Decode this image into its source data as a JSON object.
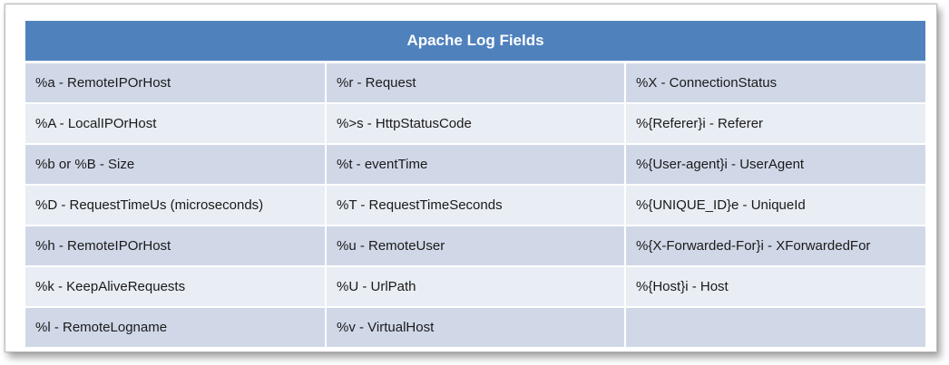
{
  "table": {
    "title": "Apache Log Fields",
    "rows": [
      [
        "%a - RemoteIPOrHost",
        "%r - Request",
        "%X - ConnectionStatus"
      ],
      [
        "%A - LocalIPOrHost",
        "%>s - HttpStatusCode",
        "%{Referer}i - Referer"
      ],
      [
        "%b or %B - Size",
        "%t - eventTime",
        "%{User-agent}i - UserAgent"
      ],
      [
        "%D - RequestTimeUs (microseconds)",
        "%T - RequestTimeSeconds",
        "%{UNIQUE_ID}e - UniqueId"
      ],
      [
        "%h - RemoteIPOrHost",
        "%u - RemoteUser",
        "%{X-Forwarded-For}i - XForwardedFor"
      ],
      [
        "%k - KeepAliveRequests",
        "%U - UrlPath",
        "%{Host}i - Host"
      ],
      [
        "%l - RemoteLogname",
        "%v - VirtualHost",
        ""
      ]
    ]
  },
  "colors": {
    "header_bg": "#4f81bd",
    "row_odd_bg": "#d0d8e8",
    "row_even_bg": "#e9edf4"
  }
}
